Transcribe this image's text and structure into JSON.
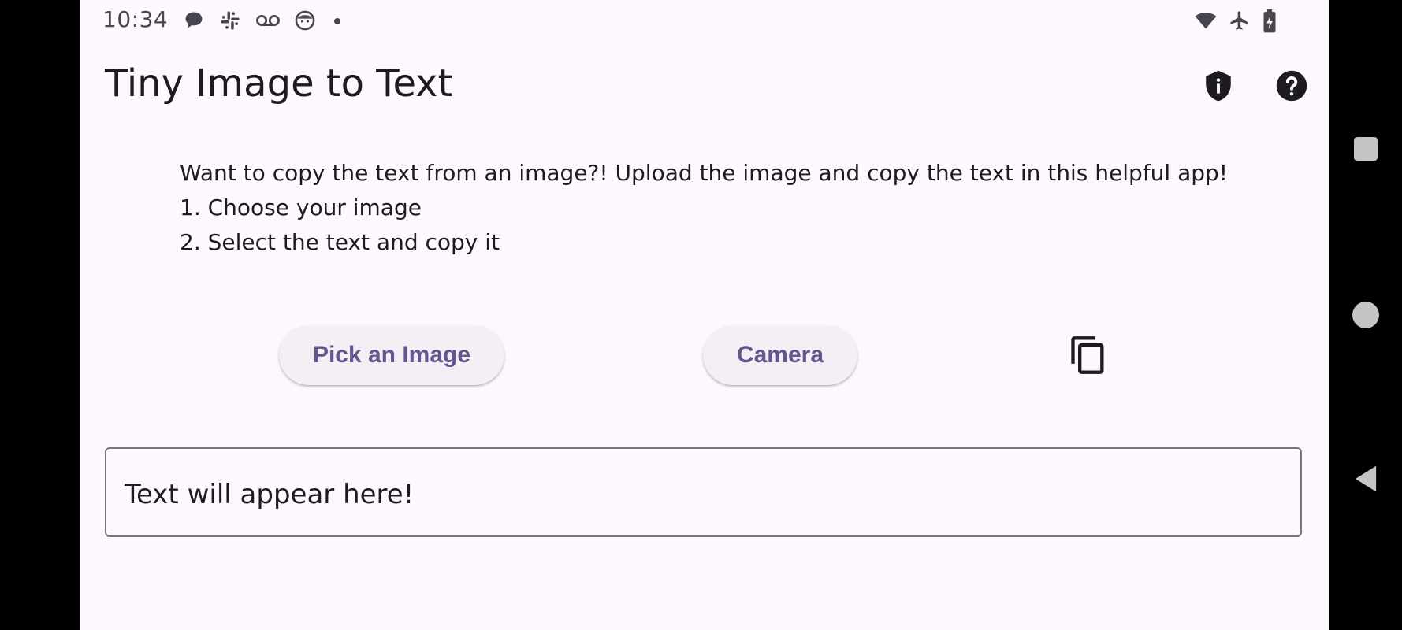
{
  "status_bar": {
    "time": "10:34",
    "left_icons": [
      "chat-bubble-icon",
      "slack-icon",
      "voicemail-icon",
      "face-icon",
      "notification-dot"
    ],
    "right_icons": [
      "wifi-icon",
      "airplane-mode-icon",
      "battery-charging-icon"
    ]
  },
  "app_bar": {
    "title": "Tiny Image to Text",
    "actions": [
      "privacy-shield-icon",
      "help-icon"
    ]
  },
  "instructions": {
    "line1": "Want to copy the text from an image?! Upload the image and copy the text in this helpful app!",
    "line2": "1. Choose your image",
    "line3": "2. Select the text and copy it"
  },
  "buttons": {
    "pick_image": "Pick an Image",
    "camera": "Camera",
    "copy_icon": "copy-icon"
  },
  "output": {
    "text": "Text will appear here!"
  },
  "nav_bar": {
    "buttons": [
      "recents-button",
      "home-button",
      "back-button"
    ]
  },
  "colors": {
    "background": "#fcf8fd",
    "accent": "#65558f",
    "text": "#1d1b20",
    "button_bg": "#f4eff5",
    "outline": "#79747e"
  }
}
